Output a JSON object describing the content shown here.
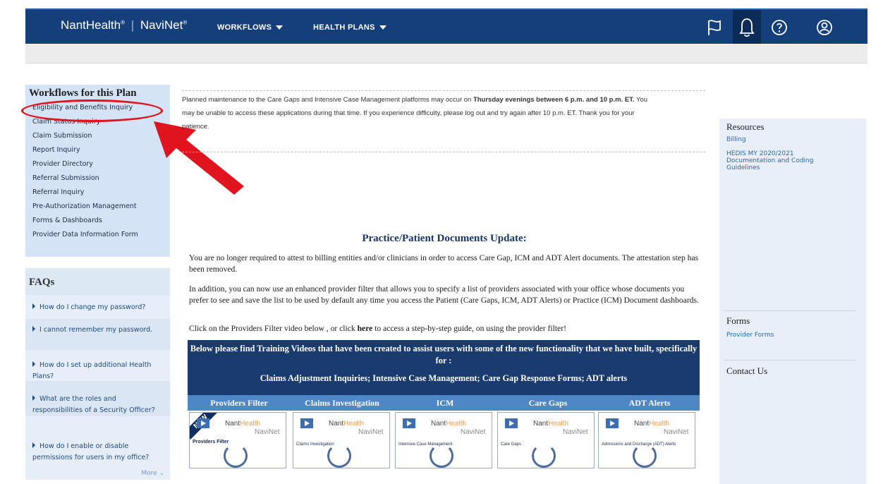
{
  "topbar": {
    "brand_left": "NantHealth",
    "brand_right": "NaviNet",
    "nav_workflows": "WORKFLOWS",
    "nav_health_plans": "HEALTH PLANS",
    "icons": [
      "flag-icon",
      "bell-icon",
      "help-icon",
      "user-icon"
    ]
  },
  "workflows": {
    "title": "Workflows for this Plan",
    "items": [
      "Eligibility and Benefits Inquiry",
      "Claim Status Inquiry",
      "Claim Submission",
      "Report Inquiry",
      "Provider Directory",
      "Referral Submission",
      "Referral Inquiry",
      "Pre-Authorization Management",
      "Forms & Dashboards",
      "Provider Data Information Form"
    ]
  },
  "faqs": {
    "title": "FAQs",
    "items": [
      "How do I change my password?",
      "I cannot remember my password.",
      "How do I set up additional Health Plans?",
      "What are the roles and responsibilities of a Security Officer?",
      "How do I enable or disable permissions for users in my office?"
    ],
    "more": "More"
  },
  "notice": {
    "line1_a": "Planned maintenance to the Care Gaps and Intensive Case Management platforms may occur on ",
    "line1_b": "Thursday evenings between 6 p.m. and 10 p.m. ET.",
    "line1_c": " You",
    "line2": "may be unable to access these applications during that time. If you experience difficulty, please log out and try again after 10 p.m. ET. Thank you for your",
    "line3": "patience."
  },
  "main": {
    "title": "Practice/Patient Documents Update:",
    "para1": "You are no longer required to attest to billing entities and/or clinicians in order to access Care Gap, ICM and ADT Alert documents. The attestation step has been removed.",
    "para2": "In addition, you can now use an enhanced provider filter that allows you to specify a list of providers associated with your office whose documents you prefer to see and save the list to be used by default any time you access the Patient (Care Gaps, ICM, ADT Alerts) or Practice (ICM) Document dashboards.",
    "para3_a": "Click on the Providers Filter video below , or click ",
    "para3_link": "here",
    "para3_b": " to access a step-by-step guide, on using the provider filter!",
    "video_intro": "Below please find Training Videos that have been created to assist users with some of the new functionality that we have built, specifically for :",
    "video_topics": "Claims Adjustment Inquiries; Intensive Case Management; Care Gap Response Forms; ADT alerts",
    "tabs": [
      "Providers Filter",
      "Claims Investigation",
      "ICM",
      "Care Gaps",
      "ADT Alerts"
    ],
    "thumb_captions": [
      "Providers Filter",
      "Claims Investigation",
      "Intensive Case Management",
      "Care Gaps",
      "Admissions and Discharge (ADT) Alerts"
    ],
    "thumb_logo_a": "Nant",
    "thumb_logo_b": "Health",
    "thumb_logo_c": "NaviNet",
    "new_badge": "NEW"
  },
  "right": {
    "resources_title": "Resources",
    "resources_links": [
      "Billing",
      "HEDIS MY 2020/2021 Documentation and Coding Guidelines"
    ],
    "forms_title": "Forms",
    "forms_links": [
      "Provider Forms"
    ],
    "contact_title": "Contact Us"
  },
  "colors": {
    "nav_bg": "#143f7a",
    "video_bg": "#1a3b6e",
    "annotation_red": "#e0141e"
  }
}
